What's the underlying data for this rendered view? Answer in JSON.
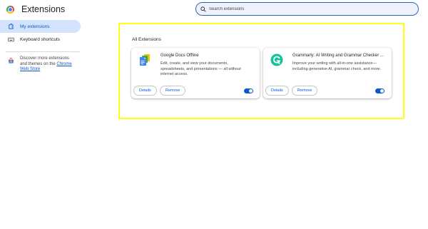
{
  "header": {
    "title": "Extensions",
    "search_placeholder": "Search extensions"
  },
  "sidebar": {
    "items": [
      {
        "label": "My extensions",
        "icon": "extension-puzzle-icon",
        "active": true
      },
      {
        "label": "Keyboard shortcuts",
        "icon": "keyboard-icon",
        "active": false
      }
    ],
    "discover_text": "Discover more extensions and themes on the ",
    "discover_link": "Chrome Web Store"
  },
  "main": {
    "section_title": "All Extensions",
    "extensions": [
      {
        "name": "Google Docs Offline",
        "description": "Edit, create, and view your documents, spreadsheets, and presentations — all without internet access.",
        "details_label": "Details",
        "remove_label": "Remove",
        "enabled": true,
        "icon": "google-docs-offline-icon"
      },
      {
        "name": "Grammarly: AI Writing and Grammar Checker ...",
        "description": "Improve your writing with all-in-one assistance—including generative AI, grammar check, and more.",
        "details_label": "Details",
        "remove_label": "Remove",
        "enabled": true,
        "icon": "grammarly-icon"
      }
    ]
  },
  "colors": {
    "accent": "#0b57d0",
    "highlight_border": "#ffff1a",
    "active_nav_bg": "#d3e3fd"
  }
}
